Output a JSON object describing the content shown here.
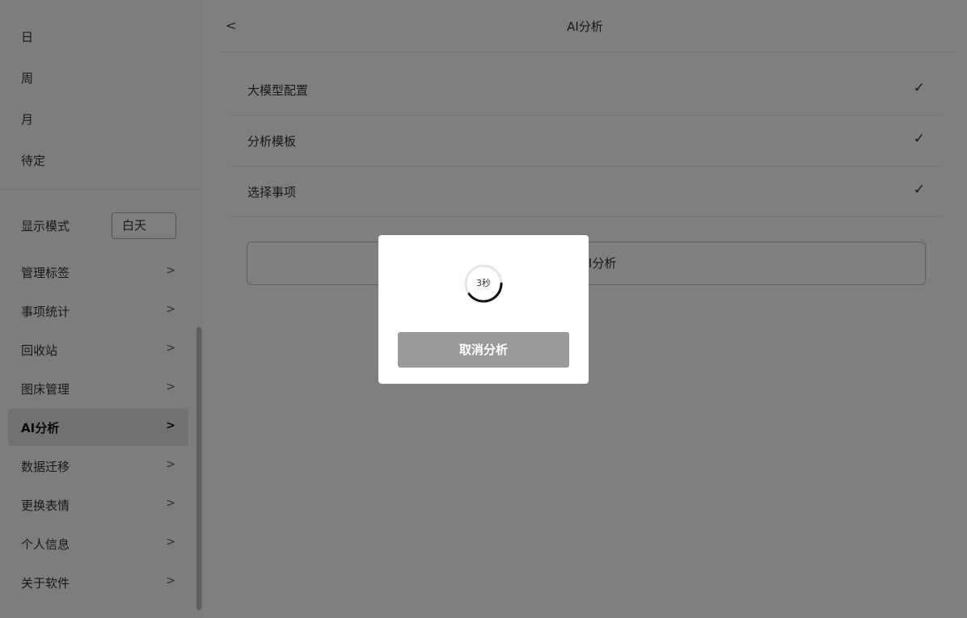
{
  "sidebar": {
    "views": [
      {
        "label": "日"
      },
      {
        "label": "周"
      },
      {
        "label": "月"
      },
      {
        "label": "待定"
      }
    ],
    "display_mode": {
      "label": "显示模式",
      "value": "白天"
    },
    "menu": [
      {
        "label": "管理标签",
        "arrow": ">"
      },
      {
        "label": "事项统计",
        "arrow": ">"
      },
      {
        "label": "回收站",
        "arrow": ">"
      },
      {
        "label": "图床管理",
        "arrow": ">"
      },
      {
        "label": "AI分析",
        "arrow": ">",
        "active": true
      },
      {
        "label": "数据迁移",
        "arrow": ">"
      },
      {
        "label": "更换表情",
        "arrow": ">"
      },
      {
        "label": "个人信息",
        "arrow": ">"
      },
      {
        "label": "关于软件",
        "arrow": ">"
      }
    ]
  },
  "main": {
    "back": "<",
    "title": "AI分析",
    "rows": [
      {
        "label": "大模型配置",
        "check": "✓"
      },
      {
        "label": "分析模板",
        "check": "✓"
      },
      {
        "label": "选择事项",
        "check": "✓"
      }
    ],
    "start_button": "开始AI分析"
  },
  "modal": {
    "countdown": "3秒",
    "progress": 0.4,
    "cancel_label": "取消分析"
  },
  "colors": {
    "overlay": "#000000",
    "cancel_button": "#9a9a9a",
    "active_menu_bg": "#e2e2e2"
  }
}
